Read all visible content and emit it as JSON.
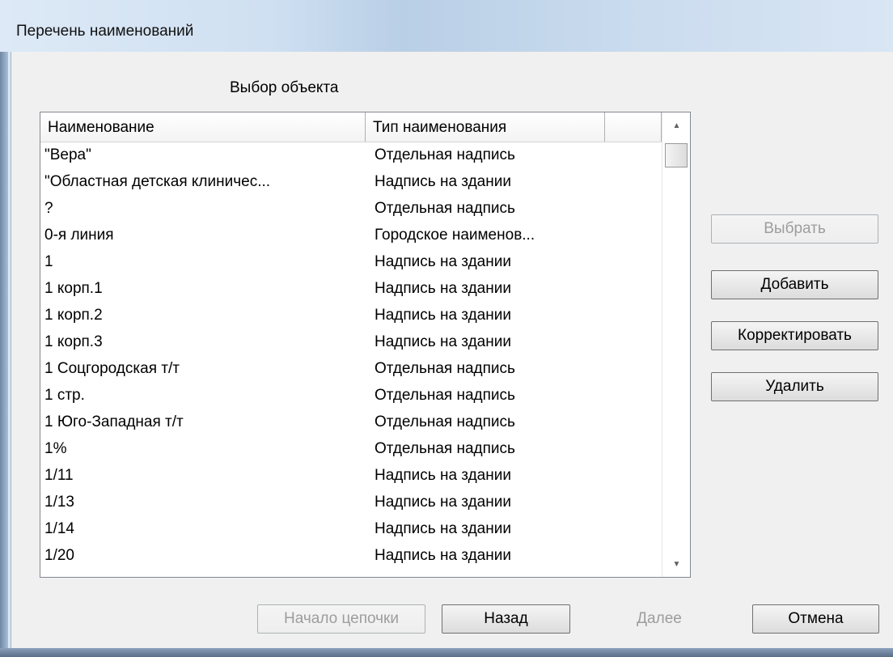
{
  "window": {
    "title": "Перечень наименований"
  },
  "caption": "Выбор  объекта",
  "list": {
    "columns": [
      "Наименование",
      "Тип наименования",
      ""
    ],
    "rows": [
      {
        "name": "\"Вера\"",
        "type": "Отдельная надпись"
      },
      {
        "name": "\"Областная детская клиничес...",
        "type": "Надпись на здании"
      },
      {
        "name": "?",
        "type": "Отдельная надпись"
      },
      {
        "name": "0-я линия",
        "type": "Городское наименов..."
      },
      {
        "name": "1",
        "type": "Надпись на здании"
      },
      {
        "name": "1 корп.1",
        "type": "Надпись на здании"
      },
      {
        "name": "1 корп.2",
        "type": "Надпись на здании"
      },
      {
        "name": "1 корп.3",
        "type": "Надпись на здании"
      },
      {
        "name": "1 Соцгородская т/т",
        "type": "Отдельная надпись"
      },
      {
        "name": "1 стр.",
        "type": "Отдельная надпись"
      },
      {
        "name": "1 Юго-Западная т/т",
        "type": "Отдельная надпись"
      },
      {
        "name": "1%",
        "type": "Отдельная надпись"
      },
      {
        "name": "1/11",
        "type": "Надпись на здании"
      },
      {
        "name": "1/13",
        "type": "Надпись на здании"
      },
      {
        "name": "1/14",
        "type": "Надпись на здании"
      },
      {
        "name": "1/20",
        "type": "Надпись на здании"
      }
    ],
    "scroll_up_icon": "arrow-up-icon",
    "scroll_down_icon": "arrow-down-icon"
  },
  "side_buttons": {
    "select": "Выбрать",
    "add": "Добавить",
    "edit": "Корректировать",
    "delete": "Удалить"
  },
  "bottom_buttons": {
    "chain_start": "Начало цепочки",
    "back": "Назад",
    "next": "Далее",
    "cancel": "Отмена"
  }
}
